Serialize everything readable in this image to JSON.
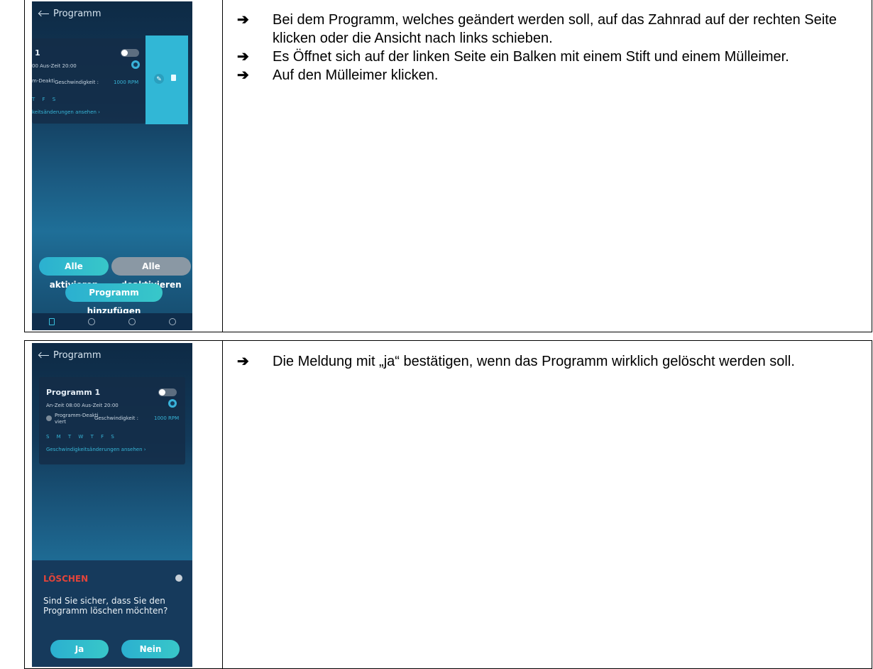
{
  "section1": {
    "phone": {
      "header_title": "Programm",
      "card_title": "1",
      "times": "00  Aus-Zeit  20:00",
      "deact_speed": "m-Deakti",
      "speed_label": "Geschwindigkeit : ",
      "speed_value": "1000 RPM",
      "days": "T F S",
      "speed_link": "keitsänderungen ansehen  ›",
      "btn_activate_all": "Alle aktivieren",
      "btn_deactivate_all": "Alle deaktivieren",
      "btn_add_program": "Programm hinzufügen"
    },
    "steps": [
      {
        "arrow": "➔",
        "text": "Bei dem Programm, welches geändert werden soll, auf das Zahnrad auf der rechten Seite klicken oder die Ansicht nach links schieben."
      },
      {
        "arrow": "➔",
        "text": "Es Öffnet sich auf der linken Seite ein Balken mit einem Stift und einem Mülleimer."
      },
      {
        "arrow": "➔",
        "text": "Auf den Mülleimer klicken."
      }
    ]
  },
  "section2": {
    "phone": {
      "header_title": "Programm",
      "card_title": "Programm  1",
      "times": "An-Zeit  08:00  Aus-Zeit  20:00",
      "deact_line1": "Programm-Deakti",
      "deact_line2": "viert",
      "speed_label": "Geschwindigkeit : ",
      "speed_value": "1000 RPM",
      "days": "S M T W T F S",
      "speed_link": "Geschwindigkeitsänderungen ansehen  ›",
      "dialog_title": "LÖSCHEN",
      "dialog_text": "Sind Sie sicher, dass Sie den Programm löschen möchten?",
      "btn_yes": "Ja",
      "btn_no": "Nein"
    },
    "steps": [
      {
        "arrow": "➔",
        "text": "Die Meldung mit „ja“ bestätigen, wenn das Programm wirklich gelöscht werden soll."
      }
    ]
  },
  "colors": {
    "accent": "#31b7d6",
    "danger": "#e4443a",
    "phone_bg": "#123a5a"
  }
}
